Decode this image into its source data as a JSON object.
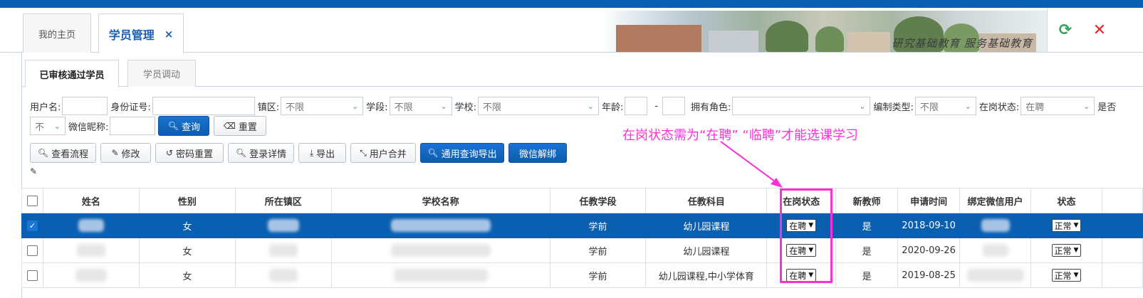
{
  "header": {
    "tabs": [
      {
        "label": "我的主页"
      },
      {
        "label": "学员管理",
        "close": "×"
      }
    ],
    "banner_motto": "研究基础教育  服务基础教育",
    "refresh_icon": "refresh-icon",
    "close_icon": "close-icon"
  },
  "subtabs": [
    {
      "label": "已审核通过学员"
    },
    {
      "label": "学员调动"
    }
  ],
  "filters": {
    "username_label": "用户名:",
    "idcard_label": "身份证号:",
    "district_label": "镇区:",
    "district_value": "不限",
    "stage_label": "学段:",
    "stage_value": "不限",
    "school_label": "学校:",
    "school_value": "不限",
    "age_label": "年龄:",
    "age_sep": "-",
    "role_label": "拥有角色:",
    "staff_label": "编制类型:",
    "staff_value": "不限",
    "status_label": "在岗状态:",
    "status_value": "在聘",
    "more_label": "是否",
    "row2_select_value": "不",
    "wechat_label": "微信昵称:",
    "query": "查询",
    "reset": "重置"
  },
  "actions": {
    "view_flow": "查看流程",
    "edit": "修改",
    "reset_pwd": "密码重置",
    "login_detail": "登录详情",
    "export": "导出",
    "merge_user": "用户合并",
    "general_export": "通用查询导出",
    "unbind_wechat": "微信解绑"
  },
  "annotation": "在岗状态需为“在聘”  “临聘”才能选课学习",
  "table": {
    "headers": [
      "姓名",
      "性别",
      "所在镇区",
      "学校名称",
      "任教学段",
      "任教科目",
      "在岗状态",
      "新教师",
      "申请时间",
      "绑定微信用户",
      "状态"
    ],
    "rows": [
      {
        "gender": "女",
        "stage": "学前",
        "subject": "幼儿园课程",
        "job_status": "在聘",
        "new_teacher": "是",
        "apply_date": "2018-09-10",
        "status": "正常"
      },
      {
        "gender": "女",
        "stage": "学前",
        "subject": "幼儿园课程",
        "job_status": "在聘",
        "new_teacher": "是",
        "apply_date": "2020-09-26",
        "status": "正常"
      },
      {
        "gender": "女",
        "stage": "学前",
        "subject": "幼儿园课程,中小学体育",
        "job_status": "在聘",
        "new_teacher": "是",
        "apply_date": "2019-08-25",
        "status": "正常"
      }
    ]
  },
  "colors": {
    "primary": "#0b5fb0",
    "annotation": "#ff2fd8"
  }
}
